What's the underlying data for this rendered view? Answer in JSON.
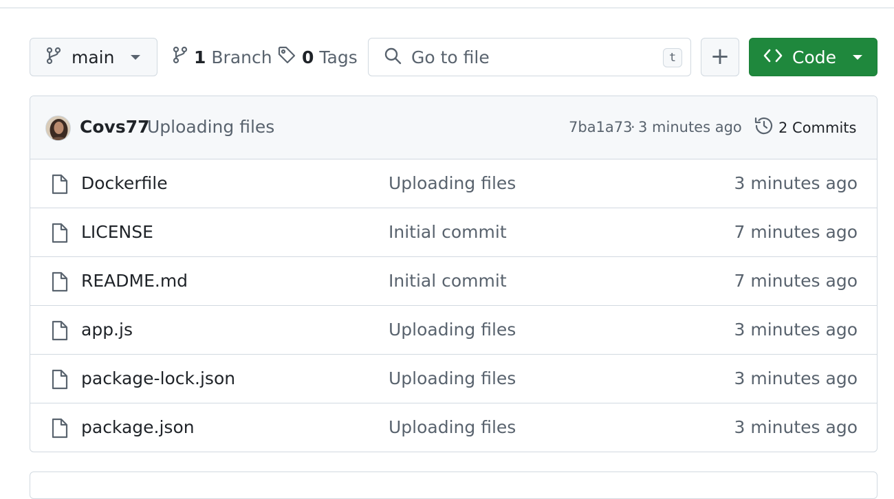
{
  "toolbar": {
    "branch_label": "main",
    "branches": {
      "count": "1",
      "label": "Branch"
    },
    "tags": {
      "count": "0",
      "label": "Tags"
    },
    "search": {
      "placeholder": "Go to file",
      "shortcut": "t"
    },
    "add_symbol": "+",
    "code_label": "Code"
  },
  "latest_commit": {
    "author": "Covs77",
    "message": "Uploading files",
    "hash": "7ba1a73",
    "separator": "·",
    "time": "3 minutes ago",
    "commits_label": "2 Commits"
  },
  "files": [
    {
      "name": "Dockerfile",
      "commit": "Uploading files",
      "time": "3 minutes ago"
    },
    {
      "name": "LICENSE",
      "commit": "Initial commit",
      "time": "7 minutes ago"
    },
    {
      "name": "README.md",
      "commit": "Initial commit",
      "time": "7 minutes ago"
    },
    {
      "name": "app.js",
      "commit": "Uploading files",
      "time": "3 minutes ago"
    },
    {
      "name": "package-lock.json",
      "commit": "Uploading files",
      "time": "3 minutes ago"
    },
    {
      "name": "package.json",
      "commit": "Uploading files",
      "time": "3 minutes ago"
    }
  ],
  "colors": {
    "code_button": "#1f883d",
    "border": "#d1d9e0",
    "muted_text": "#59636e",
    "header_bg": "#f6f8fa"
  }
}
